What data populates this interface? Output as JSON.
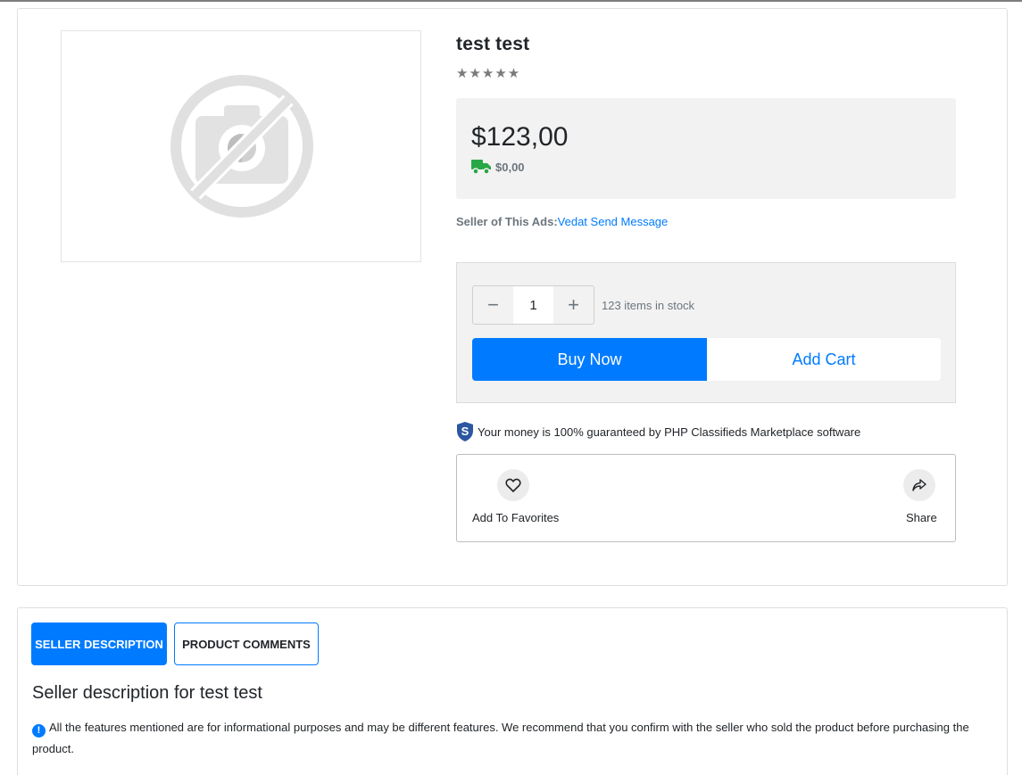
{
  "product": {
    "title": "test test",
    "stars": "★★★★★",
    "image_alt_icon": "no-photo-icon"
  },
  "pricing": {
    "price": "$123,00",
    "shipping": "$0,00",
    "shipping_icon": "truck-icon"
  },
  "seller": {
    "label": "Seller of This Ads:",
    "name": "Vedat",
    "message_link": "Send Message"
  },
  "purchase": {
    "quantity": "1",
    "decrement": "−",
    "increment": "+",
    "stock_text": "123 items in stock",
    "buy_label": "Buy Now",
    "cart_label": "Add Cart"
  },
  "guarantee": {
    "text": "Your money is 100% guaranteed by PHP Classifieds Marketplace software",
    "icon": "shield-s-icon"
  },
  "actions": {
    "favorites_label": "Add To Favorites",
    "share_label": "Share"
  },
  "tabs": [
    {
      "label": "SELLER DESCRIPTION",
      "active": true
    },
    {
      "label": "PRODUCT COMMENTS",
      "active": false
    }
  ],
  "description": {
    "title": "Seller description for test test",
    "notice_icon": "!",
    "notice": "All the features mentioned are for informational purposes and may be different features. We recommend that you confirm with the seller who sold the product before purchasing the product."
  },
  "colors": {
    "primary": "#007bff",
    "shipping_green": "#28a745",
    "shield_blue": "#2d56a0",
    "panel_bg": "#f2f2f2"
  }
}
